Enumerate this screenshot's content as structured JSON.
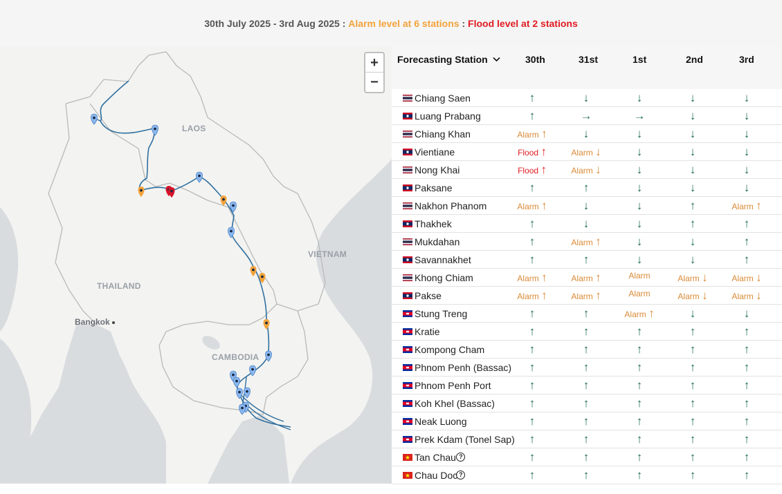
{
  "summary": {
    "date_range": "30th July 2025 - 3rd Aug 2025",
    "sep1": " : ",
    "alarm_text": "Alarm level at 6 stations",
    "sep2": " : ",
    "flood_text": "Flood level at 2 stations"
  },
  "map": {
    "labels": {
      "laos": "LAOS",
      "thailand": "THAILAND",
      "vietnam": "VIETNAM",
      "cambodia": "CAMBODIA",
      "bangkok": "Bangkok"
    },
    "zoom_in": "+",
    "zoom_out": "−"
  },
  "table": {
    "station_header": "Forecasting Station",
    "sort_icon": "chevron-down-icon",
    "days": [
      "30th",
      "31st",
      "1st",
      "2nd",
      "3rd"
    ],
    "arrows": {
      "up": "↑",
      "down": "↓",
      "right": "→"
    },
    "level_words": {
      "alarm": "Alarm",
      "flood": "Flood"
    },
    "help_icon": "?",
    "stations": [
      {
        "name": "Chiang Saen",
        "flag": "th",
        "forecast": [
          "up",
          "down",
          "down",
          "down",
          "down"
        ]
      },
      {
        "name": "Luang Prabang",
        "flag": "la",
        "forecast": [
          "up",
          "right",
          "right",
          "down",
          "down"
        ]
      },
      {
        "name": "Chiang Khan",
        "flag": "th",
        "forecast": [
          "alarm-up",
          "down",
          "down",
          "down",
          "down"
        ]
      },
      {
        "name": "Vientiane",
        "flag": "la",
        "forecast": [
          "flood-up",
          "alarm-down",
          "down",
          "down",
          "down"
        ]
      },
      {
        "name": "Nong Khai",
        "flag": "th",
        "forecast": [
          "flood-up",
          "alarm-down",
          "down",
          "down",
          "down"
        ]
      },
      {
        "name": "Paksane",
        "flag": "la",
        "forecast": [
          "up",
          "up",
          "down",
          "down",
          "down"
        ]
      },
      {
        "name": "Nakhon Phanom",
        "flag": "th",
        "forecast": [
          "alarm-up",
          "down",
          "down",
          "up",
          "alarm-up"
        ]
      },
      {
        "name": "Thakhek",
        "flag": "la",
        "forecast": [
          "up",
          "down",
          "down",
          "up",
          "up"
        ]
      },
      {
        "name": "Mukdahan",
        "flag": "th",
        "forecast": [
          "up",
          "alarm-up",
          "down",
          "down",
          "up"
        ]
      },
      {
        "name": "Savannakhet",
        "flag": "la",
        "forecast": [
          "up",
          "up",
          "down",
          "down",
          "up"
        ]
      },
      {
        "name": "Khong Chiam",
        "flag": "th",
        "forecast": [
          "alarm-up",
          "alarm-up",
          "alarm",
          "alarm-down",
          "alarm-down"
        ]
      },
      {
        "name": "Pakse",
        "flag": "la",
        "forecast": [
          "alarm-up",
          "alarm-up",
          "alarm",
          "alarm-down",
          "alarm-down"
        ]
      },
      {
        "name": "Stung Treng",
        "flag": "kh",
        "forecast": [
          "up",
          "up",
          "alarm-up",
          "down",
          "down"
        ]
      },
      {
        "name": "Kratie",
        "flag": "kh",
        "forecast": [
          "up",
          "up",
          "up",
          "up",
          "up"
        ]
      },
      {
        "name": "Kompong Cham",
        "flag": "kh",
        "forecast": [
          "up",
          "up",
          "up",
          "up",
          "up"
        ]
      },
      {
        "name": "Phnom Penh (Bassac)",
        "flag": "kh",
        "forecast": [
          "up",
          "up",
          "up",
          "up",
          "up"
        ]
      },
      {
        "name": "Phnom Penh Port",
        "flag": "kh",
        "forecast": [
          "up",
          "up",
          "up",
          "up",
          "up"
        ]
      },
      {
        "name": "Koh Khel (Bassac)",
        "flag": "kh",
        "forecast": [
          "up",
          "up",
          "up",
          "up",
          "up"
        ]
      },
      {
        "name": "Neak Luong",
        "flag": "kh",
        "forecast": [
          "up",
          "up",
          "up",
          "up",
          "up"
        ]
      },
      {
        "name": "Prek Kdam (Tonel Sap)",
        "flag": "kh",
        "forecast": [
          "up",
          "up",
          "up",
          "up",
          "up"
        ]
      },
      {
        "name": "Tan Chau",
        "flag": "vn",
        "help": true,
        "forecast": [
          "up",
          "up",
          "up",
          "up",
          "up"
        ]
      },
      {
        "name": "Chau Doc",
        "flag": "vn",
        "help": true,
        "forecast": [
          "up",
          "up",
          "up",
          "up",
          "up"
        ]
      }
    ]
  },
  "colors": {
    "alarm": "#f2a33a",
    "flood": "#e01b22",
    "normal_arrow": "#1b6b4c",
    "river": "#2f6f9f",
    "marker_normal": "#8ab8f0",
    "marker_alarm": "#f2a33a",
    "marker_flood": "#d8132a"
  }
}
